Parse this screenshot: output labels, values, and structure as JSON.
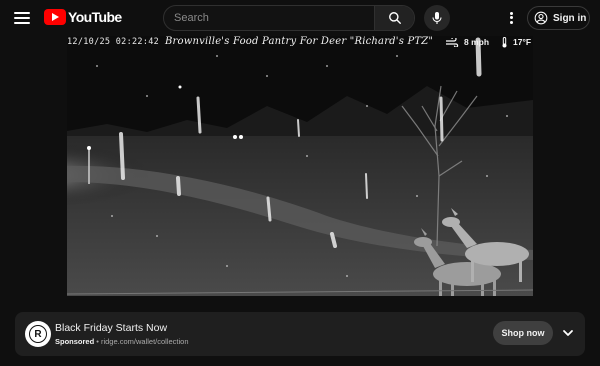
{
  "header": {
    "logo_text": "YouTube",
    "search_placeholder": "Search",
    "signin_label": "Sign in"
  },
  "video": {
    "timestamp": "12/10/25 02:22:42",
    "camera_title": "Brownville's Food Pantry For Deer \"Richard's PTZ\"",
    "wind": "8 mph",
    "temperature": "17°F",
    "icons": [
      "wind-icon",
      "thermometer-icon"
    ]
  },
  "ad": {
    "title": "Black Friday Starts Now",
    "sponsored_label": "Sponsored",
    "separator": " • ",
    "url": "ridge.com/wallet/collection",
    "cta_label": "Shop now",
    "logo_letter": "R"
  },
  "colors": {
    "brand_red": "#ff0000",
    "background": "#0f0f0f",
    "ad_background": "#1f1f1f"
  }
}
